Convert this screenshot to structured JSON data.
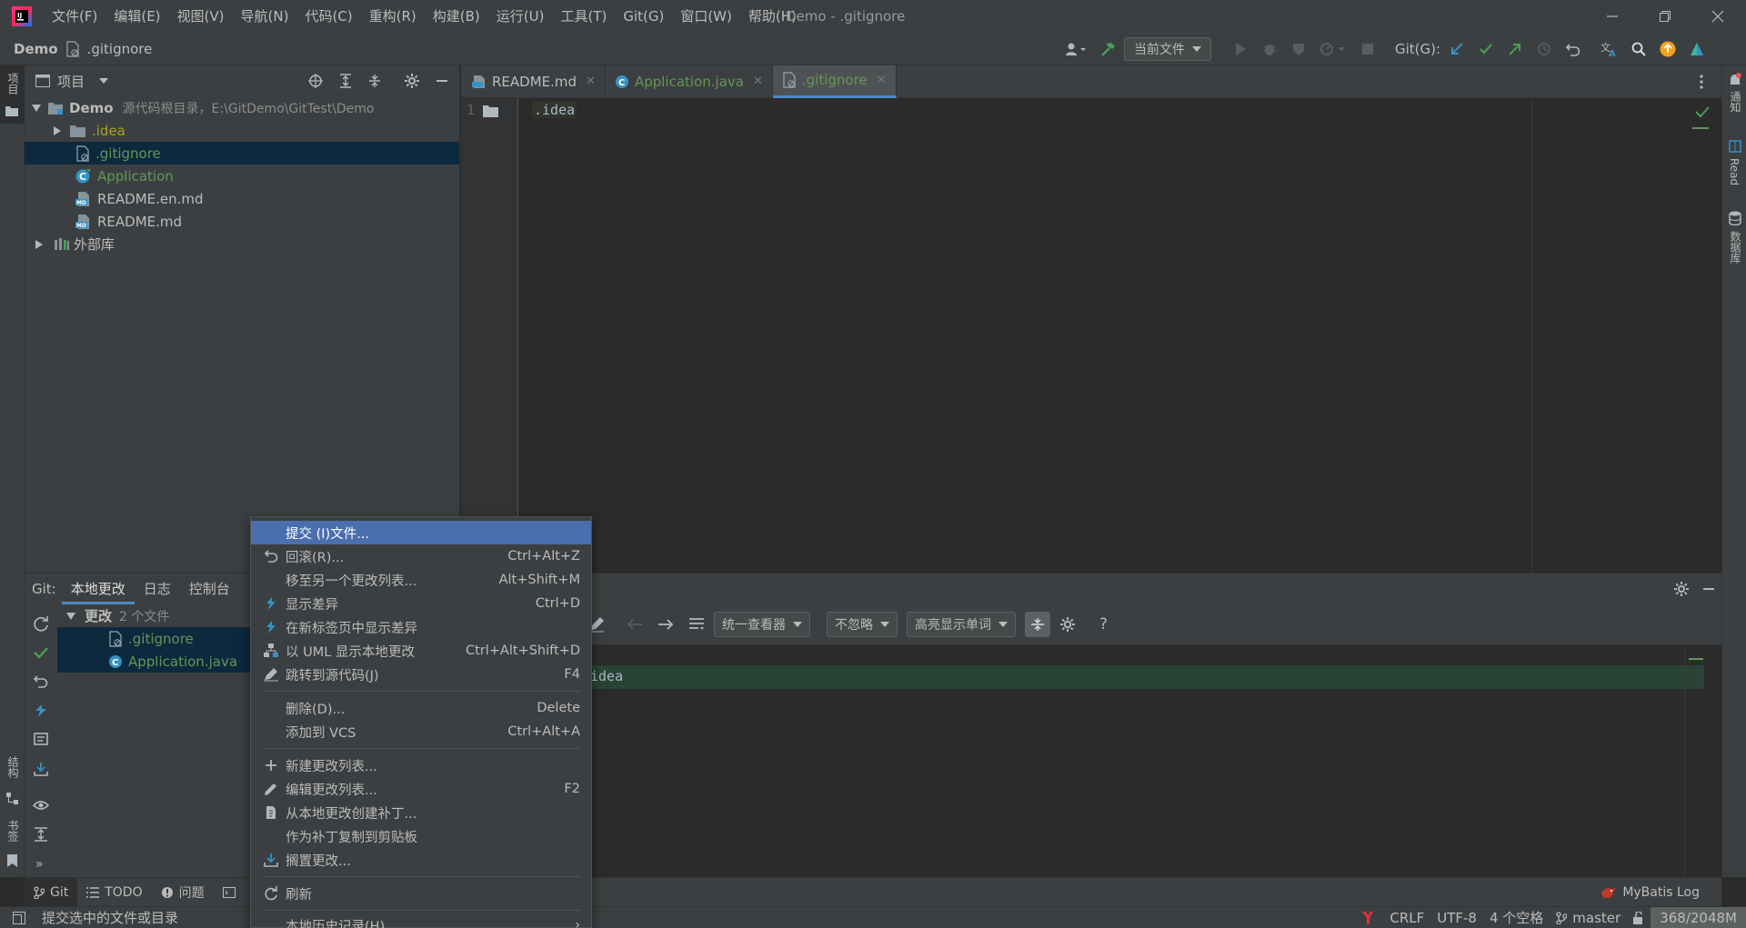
{
  "window": {
    "title": "Demo - .gitignore",
    "menu": [
      "文件(F)",
      "编辑(E)",
      "视图(V)",
      "导航(N)",
      "代码(C)",
      "重构(R)",
      "构建(B)",
      "运行(U)",
      "工具(T)",
      "Git(G)",
      "窗口(W)",
      "帮助(H)"
    ]
  },
  "navbar": {
    "project": "Demo",
    "file": ".gitignore",
    "run_config": "当前文件",
    "git_label": "Git(G):"
  },
  "left_strip": {
    "project_tab": "项目",
    "structure_tab": "结构",
    "bookmarks_tab": "书签"
  },
  "right_strip": {
    "notifications_tab": "通知",
    "read_tab": "Read",
    "database_tab": "数据库"
  },
  "project_panel": {
    "title": "项目",
    "tree": [
      {
        "label": "Demo",
        "sublabel": "源代码根目录，E:\\GitDemo\\GitTest\\Demo"
      },
      {
        "label": ".idea"
      },
      {
        "label": ".gitignore"
      },
      {
        "label": "Application"
      },
      {
        "label": "README.en.md"
      },
      {
        "label": "README.md"
      },
      {
        "label": "外部库"
      }
    ]
  },
  "editor": {
    "tabs": [
      "README.md",
      "Application.java",
      ".gitignore"
    ],
    "active_tab": ".gitignore",
    "line_number": "1",
    "code_line": ".idea"
  },
  "git_panel": {
    "prefix": "Git:",
    "tabs": [
      "本地更改",
      "日志",
      "控制台"
    ],
    "group_label": "更改",
    "group_count": "2 个文件",
    "files": [
      ".gitignore",
      "Application.java"
    ],
    "diff_viewer": "统一查看器",
    "ignore_mode": "不忽略",
    "highlight_mode": "高亮显示单词",
    "diff_line": "idea"
  },
  "context_menu": {
    "items": [
      {
        "label": "提交 (I)文件...",
        "shortcut": ""
      },
      {
        "label": "回滚(R)...",
        "shortcut": "Ctrl+Alt+Z"
      },
      {
        "label": "移至另一个更改列表...",
        "shortcut": "Alt+Shift+M"
      },
      {
        "label": "显示差异",
        "shortcut": "Ctrl+D"
      },
      {
        "label": "在新标签页中显示差异",
        "shortcut": ""
      },
      {
        "label": "以 UML 显示本地更改",
        "shortcut": "Ctrl+Alt+Shift+D"
      },
      {
        "label": "跳转到源代码(J)",
        "shortcut": "F4"
      },
      {
        "label": "删除(D)...",
        "shortcut": "Delete"
      },
      {
        "label": "添加到 VCS",
        "shortcut": "Ctrl+Alt+A"
      },
      {
        "label": "新建更改列表...",
        "shortcut": ""
      },
      {
        "label": "编辑更改列表...",
        "shortcut": "F2"
      },
      {
        "label": "从本地更改创建补丁...",
        "shortcut": ""
      },
      {
        "label": "作为补丁复制到剪贴板",
        "shortcut": ""
      },
      {
        "label": "搁置更改...",
        "shortcut": ""
      },
      {
        "label": "刷新",
        "shortcut": ""
      },
      {
        "label": "本地历史记录(H)",
        "shortcut": ""
      }
    ]
  },
  "bottom_tabs": [
    "Git",
    "TODO",
    "问题"
  ],
  "mybatis_log": "MyBatis Log",
  "statusbar": {
    "message": "提交选中的文件或目录",
    "line_sep": "CRLF",
    "encoding": "UTF-8",
    "indent": "4 个空格",
    "branch": "master",
    "memory": "368/2048M"
  },
  "colors": {
    "accent": "#4a88c7",
    "menu_highlight": "#4b6eaf",
    "vcs_new_file": "#629755",
    "vcs_ignored": "#848504",
    "success": "#499c54"
  }
}
